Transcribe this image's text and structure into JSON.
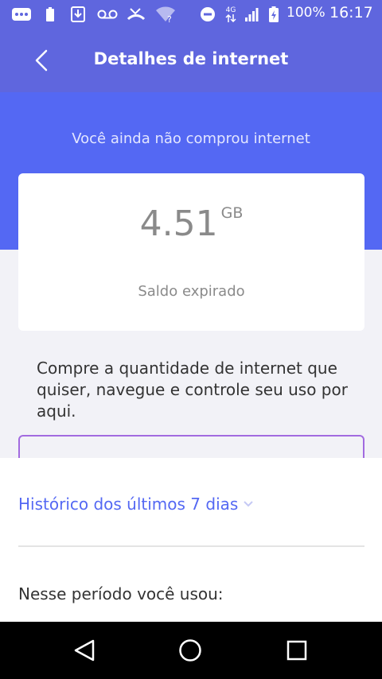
{
  "status_bar": {
    "battery_percent": "100%",
    "time": "16:17",
    "network_type": "4G",
    "icons": [
      "chat-icon",
      "battery-saver-icon",
      "download-icon",
      "voicemail-icon",
      "missed-call-icon",
      "wifi-question-icon",
      "do-not-disturb-icon",
      "network-icon",
      "signal-icon",
      "battery-charging-icon"
    ]
  },
  "header": {
    "title": "Detalhes de internet"
  },
  "hero": {
    "note": "Você ainda não comprou internet"
  },
  "card": {
    "amount": "4.51",
    "unit": "GB",
    "status": "Saldo expirado"
  },
  "promo": {
    "text": "Compre a quantidade de internet que quiser, navegue e controle seu uso por aqui."
  },
  "history": {
    "label": "Histórico dos últimos 7 dias"
  },
  "usage": {
    "period_label": "Nesse período você usou:"
  },
  "colors": {
    "app_bar": "#5f66de",
    "hero": "#5468f3",
    "accent": "#5468f3",
    "outline": "#a26be0"
  }
}
